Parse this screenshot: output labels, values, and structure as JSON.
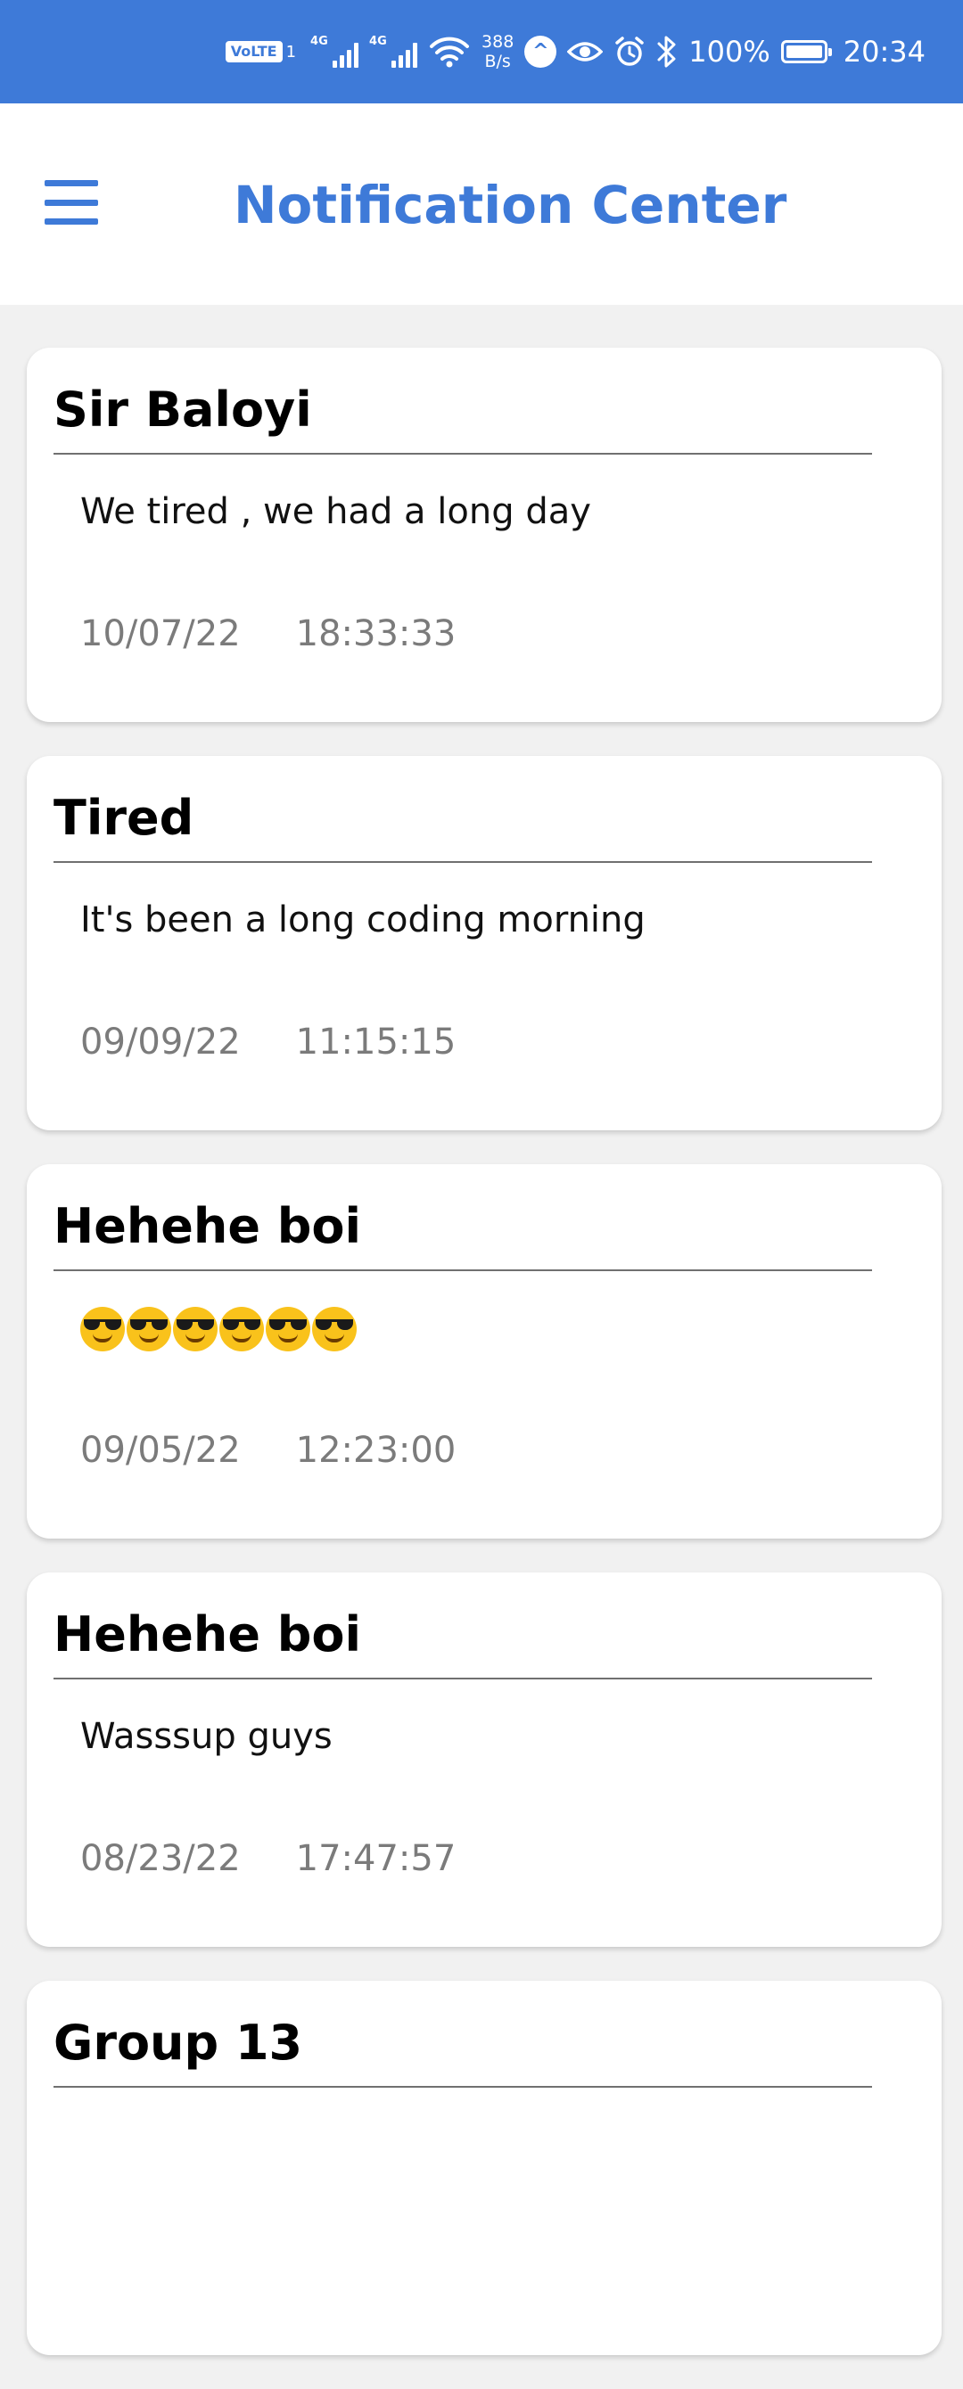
{
  "status_bar": {
    "volte": "VoLTE",
    "sim": "1",
    "net1": "4G",
    "net2": "4G",
    "speed_value": "388",
    "speed_unit": "B/s",
    "battery_percent": "100%",
    "battery_level": 1.0,
    "time": "20:34",
    "icons": [
      "volte-icon",
      "signal-icon",
      "signal-icon",
      "wifi-icon",
      "navigation-icon",
      "eye-icon",
      "alarm-icon",
      "bluetooth-icon",
      "battery-icon"
    ]
  },
  "app_bar": {
    "title": "Notification Center",
    "menu_icon": "hamburger-menu-icon"
  },
  "colors": {
    "primary": "#3e7ad8",
    "background": "#f1f1f1",
    "card": "#ffffff",
    "meta_text": "#7b7b7b"
  },
  "notifications": [
    {
      "title": "Sir Baloyi",
      "message": "We tired , we had a long day",
      "date": "10/07/22",
      "time": "18:33:33"
    },
    {
      "title": "Tired",
      "message": "It's been a long coding morning",
      "date": "09/09/22",
      "time": "11:15:15"
    },
    {
      "title": "Hehehe boi",
      "message": "😎😎😎😎😎😎",
      "date": "09/05/22",
      "time": "12:23:00"
    },
    {
      "title": "Hehehe boi",
      "message": "Wasssup guys",
      "date": "08/23/22",
      "time": "17:47:57"
    },
    {
      "title": "Group 13",
      "message": "",
      "date": "",
      "time": ""
    }
  ]
}
